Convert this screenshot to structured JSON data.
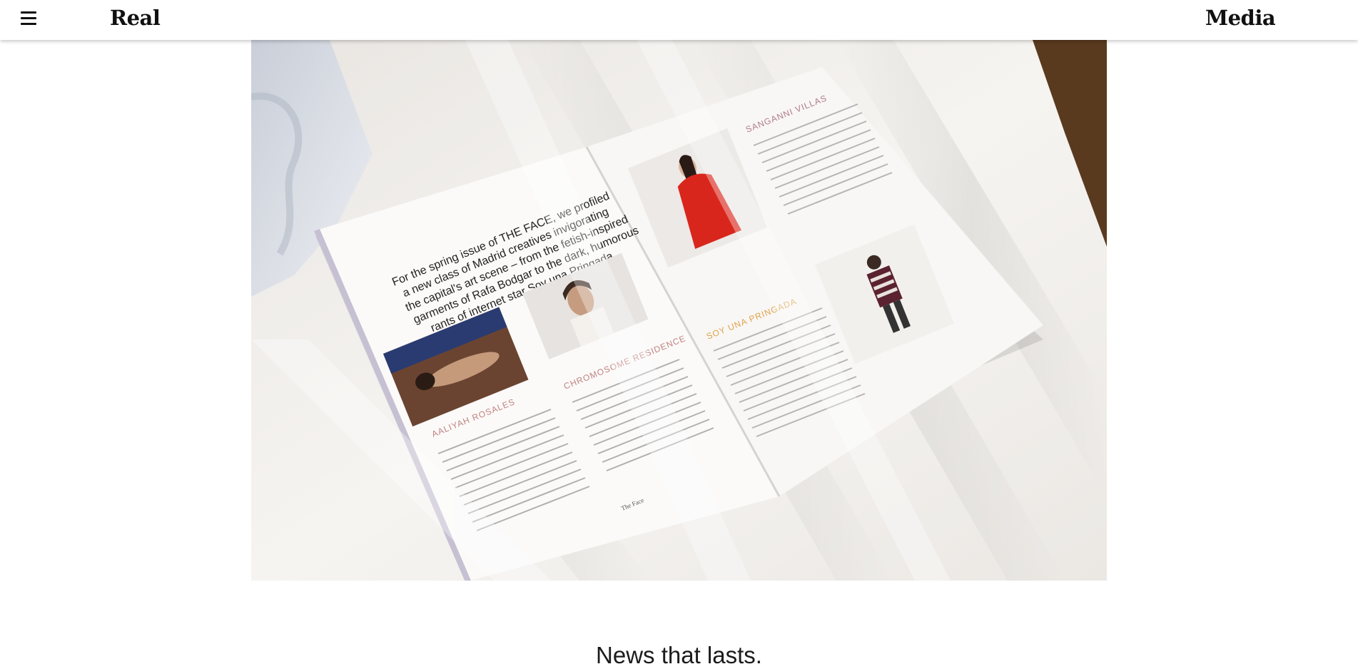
{
  "header": {
    "menu_icon": "hamburger-menu-icon",
    "brand_left": "Real",
    "brand_right": "Media"
  },
  "hero": {
    "image_description_icon": "magazine-photo",
    "magazine": {
      "intro": [
        "For the spring issue of THE FACE, we profiled",
        "a new class of Madrid creatives invigorating",
        "the capital's art scene – from the fetish-inspired",
        "garments of Rafa Bodgar to the dark, humorous",
        "rants of internet star Soy una Pringada."
      ],
      "heading_1": "AALIYAH ROSALES",
      "heading_2": "CHROMOSOME RESIDENCE",
      "heading_3": "SOY UNA PRINGADA",
      "heading_4": "SANGANNI VILLAS",
      "footer": "The Face"
    }
  },
  "main": {
    "tagline": "News that lasts."
  },
  "colors": {
    "header_bg": "#ffffff",
    "brand_text": "#111111",
    "accent_red": "#d9261c"
  }
}
